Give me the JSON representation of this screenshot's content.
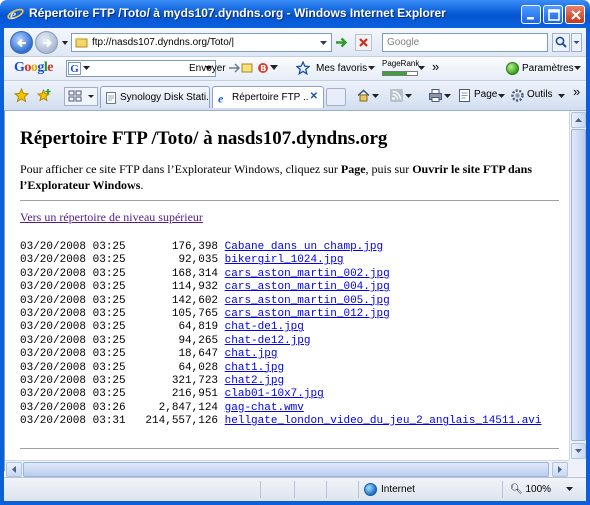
{
  "window": {
    "title": "Répertoire FTP /Toto/ à myds107.dyndns.org - Windows Internet Explorer"
  },
  "address_bar": {
    "url": "ftp://nasds107.dyndns.org/Toto/|",
    "search_placeholder": "Google"
  },
  "google_toolbar": {
    "logo": [
      "G",
      "o",
      "o",
      "g",
      "l",
      "e"
    ],
    "send_label": "Envoyer",
    "favorites_label": "Mes favoris",
    "pagerank_label": "PageRank",
    "pagerank_fraction": 0.7,
    "more_label": "»",
    "settings_label": "Paramètres"
  },
  "tabs": [
    {
      "label": "Synology Disk Stati...",
      "active": false
    },
    {
      "label": "Répertoire FTP ...",
      "active": true
    }
  ],
  "command_bar": {
    "page_label": "Page",
    "tools_label": "Outils",
    "more_label": "»"
  },
  "content": {
    "heading": "Répertoire FTP /Toto/ à nasds107.dyndns.org",
    "intro_before": "Pour afficher ce site FTP dans l’Explorateur Windows, cliquez sur ",
    "intro_page": "Page",
    "intro_middle": ", puis sur ",
    "intro_open": "Ouvrir le site FTP dans l’Explorateur Windows",
    "intro_end": ".",
    "parent_link": "Vers un répertoire de niveau supérieur",
    "files": [
      {
        "date": "03/20/2008",
        "time": "03:25",
        "size": "176,398",
        "name": "Cabane dans un champ.jpg"
      },
      {
        "date": "03/20/2008",
        "time": "03:25",
        "size": "92,035",
        "name": "bikergirl_1024.jpg"
      },
      {
        "date": "03/20/2008",
        "time": "03:25",
        "size": "168,314",
        "name": "cars_aston_martin_002.jpg"
      },
      {
        "date": "03/20/2008",
        "time": "03:25",
        "size": "114,932",
        "name": "cars_aston_martin_004.jpg"
      },
      {
        "date": "03/20/2008",
        "time": "03:25",
        "size": "142,602",
        "name": "cars_aston_martin_005.jpg"
      },
      {
        "date": "03/20/2008",
        "time": "03:25",
        "size": "105,765",
        "name": "cars_aston_martin_012.jpg"
      },
      {
        "date": "03/20/2008",
        "time": "03:25",
        "size": "64,819",
        "name": "chat-de1.jpg"
      },
      {
        "date": "03/20/2008",
        "time": "03:25",
        "size": "94,265",
        "name": "chat-de12.jpg"
      },
      {
        "date": "03/20/2008",
        "time": "03:25",
        "size": "18,647",
        "name": "chat.jpg"
      },
      {
        "date": "03/20/2008",
        "time": "03:25",
        "size": "64,028",
        "name": "chat1.jpg"
      },
      {
        "date": "03/20/2008",
        "time": "03:25",
        "size": "321,723",
        "name": "chat2.jpg"
      },
      {
        "date": "03/20/2008",
        "time": "03:25",
        "size": "216,951",
        "name": "clab01-10x7.jpg"
      },
      {
        "date": "03/20/2008",
        "time": "03:26",
        "size": "2,847,124",
        "name": "gag-chat.wmv"
      },
      {
        "date": "03/20/2008",
        "time": "03:31",
        "size": "214,557,126",
        "name": "hellgate_london_video_du_jeu_2_anglais_14511.avi"
      }
    ]
  },
  "status_bar": {
    "zone_label": "Internet",
    "zoom_label": "100%"
  },
  "colors": {
    "titlebar": "#0a5fd8",
    "link": "#0000ee",
    "visited_link": "#551a8b"
  }
}
